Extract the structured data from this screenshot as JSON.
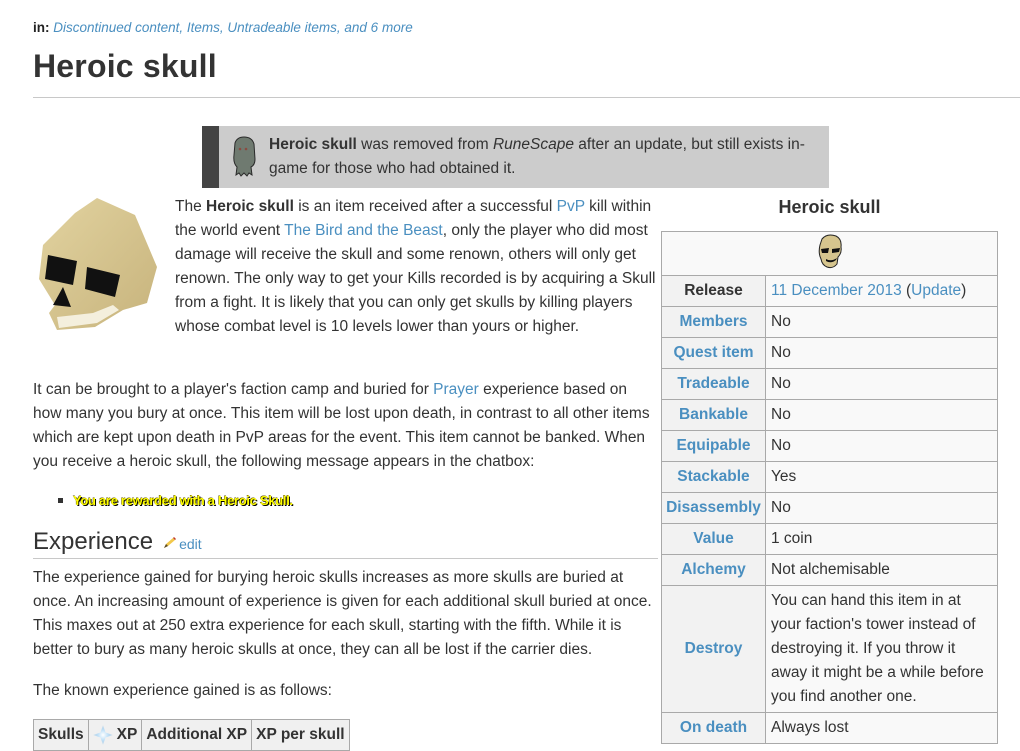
{
  "categories": {
    "label": "in:",
    "items_text": "Discontinued content, Items, Untradeable items, and 6 more"
  },
  "page_title": "Heroic skull",
  "notice": {
    "icon": "ghost-icon",
    "bold": "Heroic skull",
    "text1": " was removed from ",
    "italic": "RuneScape",
    "text2": " after an update, but still exists in-game for those who had obtained it."
  },
  "intro": {
    "image": "heroic-skull-image",
    "t1": "The ",
    "bold": "Heroic skull",
    "t2": " is an item received after a successful ",
    "link_pvp": "PvP",
    "t3": " kill within the world event ",
    "link_event": "The Bird and the Beast",
    "t4": ", only the player who did most damage will receive the skull and some renown, others will only get renown. The only way to get your Kills recorded is by acquiring a Skull from a fight. It is likely that you can only get skulls by killing players whose combat level is 10 levels lower than yours or higher."
  },
  "para2": {
    "t1": "It can be brought to a player's faction camp and buried for ",
    "link_prayer": "Prayer",
    "t2": " experience based on how many you bury at once. This item will be lost upon death, in contrast to all other items which are kept upon death in PvP areas for the event. This item cannot be banked. When you receive a heroic skull, the following message appears in the chatbox:"
  },
  "chat_message": "You are rewarded with a Heroic Skull.",
  "experience_section": {
    "heading": "Experience",
    "edit_label": "edit",
    "para1": "The experience gained for burying heroic skulls increases as more skulls are buried at once. An increasing amount of experience is given for each additional skull buried at once. This maxes out at 250 extra experience for each skull, starting with the fifth. While it is better to bury as many heroic skulls at once, they can all be lost if the carrier dies.",
    "para2": "The known experience gained is as follows:",
    "table_headers": [
      "Skulls",
      "XP",
      "Additional XP",
      "XP per skull"
    ]
  },
  "infobox": {
    "title": "Heroic skull",
    "image": "heroic-skull-icon",
    "release": {
      "label": "Release",
      "date": "11 December 2013",
      "open": " (",
      "update_link": "Update",
      "close": ")"
    },
    "rows": [
      {
        "label": "Members",
        "value": "No"
      },
      {
        "label": "Quest item",
        "value": "No"
      },
      {
        "label": "Tradeable",
        "value": "No"
      },
      {
        "label": "Bankable",
        "value": "No"
      },
      {
        "label": "Equipable",
        "value": "No"
      },
      {
        "label": "Stackable",
        "value": "Yes"
      },
      {
        "label": "Disassembly",
        "value": "No"
      },
      {
        "label": "Value",
        "value": "1 coin"
      },
      {
        "label": "Alchemy",
        "value": "Not alchemisable"
      },
      {
        "label": "Destroy",
        "value": "You can hand this item in at your faction's tower instead of destroying it. If you throw it away it might be a while before you find another one."
      },
      {
        "label": "On death",
        "value": "Always lost"
      }
    ]
  },
  "colors": {
    "link": "#4a8fc0",
    "text": "#333333",
    "notice_bg": "#cccccc",
    "notice_bar": "#444444",
    "chat_yellow": "#ffff00"
  }
}
